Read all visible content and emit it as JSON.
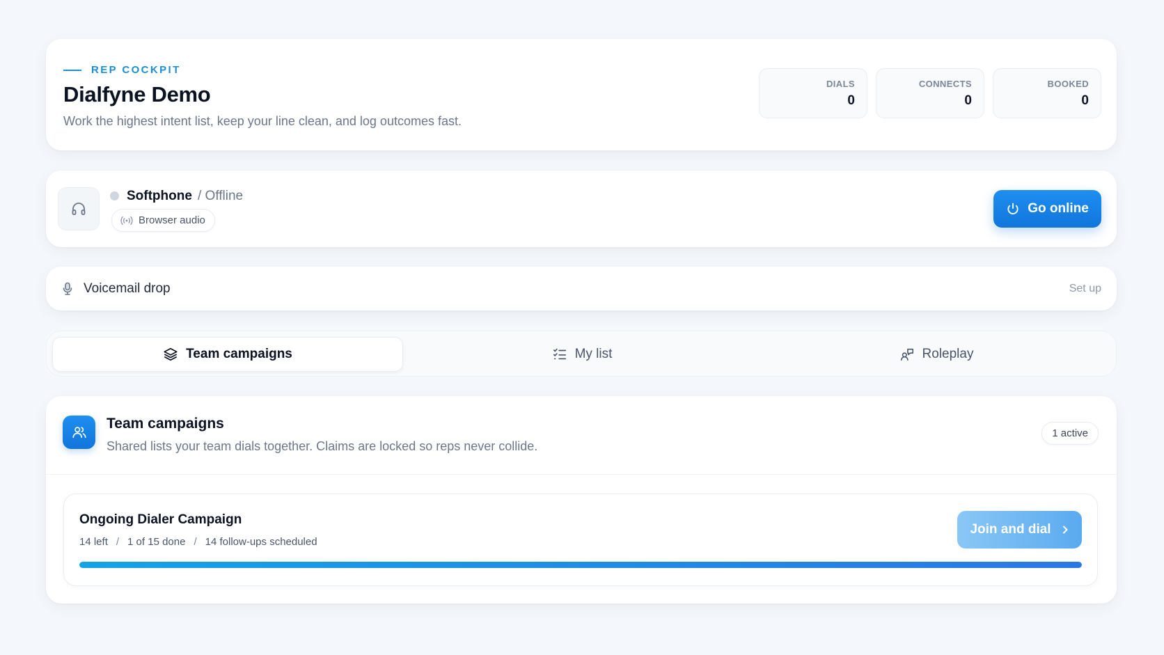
{
  "header": {
    "eyebrow": "REP COCKPIT",
    "title": "Dialfyne Demo",
    "subtitle": "Work the highest intent list, keep your line clean, and log outcomes fast.",
    "stats": [
      {
        "label": "DIALS",
        "value": "0"
      },
      {
        "label": "CONNECTS",
        "value": "0"
      },
      {
        "label": "BOOKED",
        "value": "0"
      }
    ]
  },
  "softphone": {
    "icon": "headphones-icon",
    "title": "Softphone",
    "status": "/ Offline",
    "audio_label": "Browser audio",
    "go_online_label": "Go online"
  },
  "voicemail": {
    "label": "Voicemail drop",
    "action": "Set up"
  },
  "tabs": [
    {
      "label": "Team campaigns",
      "icon": "layers-icon",
      "active": true
    },
    {
      "label": "My list",
      "icon": "checklist-icon",
      "active": false
    },
    {
      "label": "Roleplay",
      "icon": "roleplay-icon",
      "active": false
    }
  ],
  "campaigns": {
    "title": "Team campaigns",
    "description": "Shared lists your team dials together. Claims are locked so reps never collide.",
    "badge": "1 active",
    "items": [
      {
        "name": "Ongoing Dialer Campaign",
        "left": "14 left",
        "done": "1 of 15 done",
        "followups": "14 follow-ups scheduled",
        "separator": "/",
        "action": "Join and dial",
        "progress_percent": 100
      }
    ]
  },
  "colors": {
    "accent": "#1a8fd6",
    "primary_button": "#1682e6",
    "join_button": "#6fb8f3",
    "background": "#f4f7fb"
  }
}
